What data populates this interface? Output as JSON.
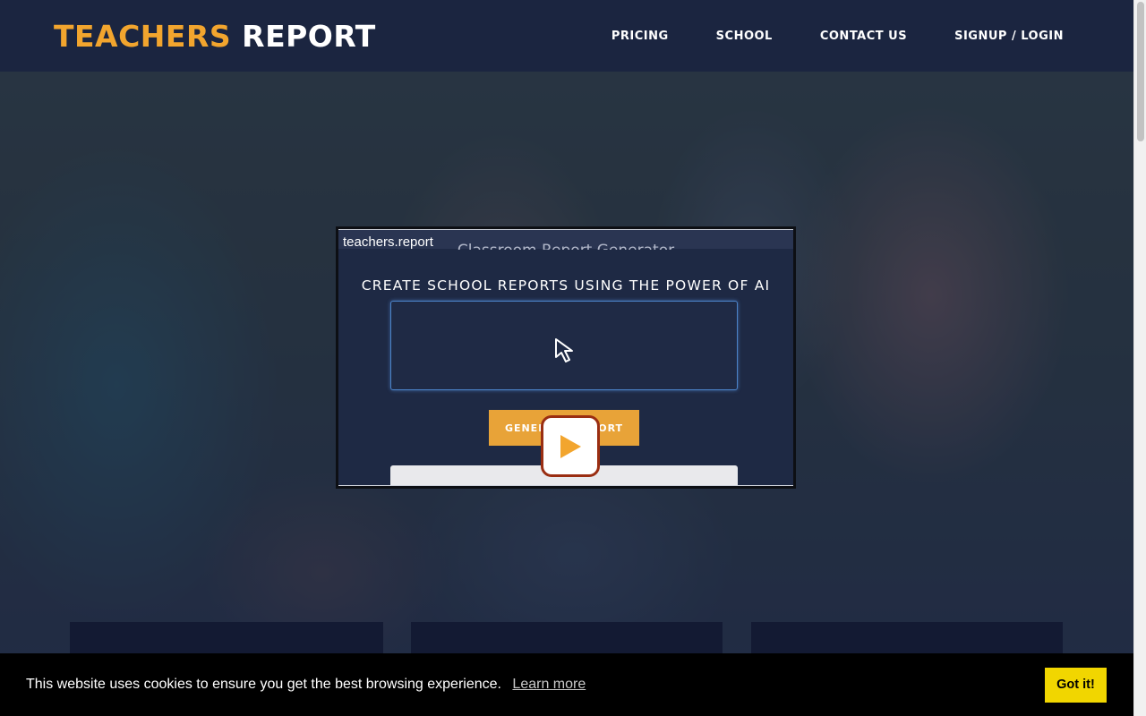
{
  "header": {
    "logo_part1": "TEACHERS",
    "logo_part2": "REPORT",
    "nav": [
      "PRICING",
      "SCHOOL",
      "CONTACT US",
      "SIGNUP / LOGIN"
    ]
  },
  "video": {
    "source_label": "teachers.report",
    "partial_title": "Classroom Report Generator",
    "heading": "CREATE SCHOOL REPORTS USING THE POWER OF AI",
    "button_label": "GENERATE REPORT"
  },
  "cookie": {
    "message": "This website uses cookies to ensure you get the best browsing experience.",
    "link_label": "Learn more",
    "button_label": "Got it!"
  },
  "colors": {
    "brand_orange": "#f2a52e",
    "header_bg": "#1b2540",
    "cookie_button": "#f1d600"
  },
  "icons": [
    "cursor-arrow-icon",
    "play-icon"
  ]
}
